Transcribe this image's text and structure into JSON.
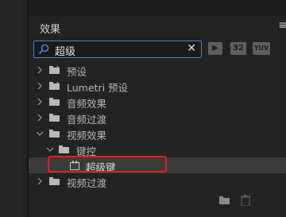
{
  "panel": {
    "title": "效果",
    "menu_icon": "≡"
  },
  "search": {
    "value": "超级",
    "clear_label": "✕"
  },
  "filters": [
    {
      "label": "▶"
    },
    {
      "label": "32"
    },
    {
      "label": "YUV"
    }
  ],
  "tree": [
    {
      "label": "预设",
      "expanded": false,
      "level": 0,
      "kind": "preset-folder"
    },
    {
      "label": "Lumetri 预设",
      "expanded": false,
      "level": 0,
      "kind": "preset-folder"
    },
    {
      "label": "音频效果",
      "expanded": false,
      "level": 0,
      "kind": "folder"
    },
    {
      "label": "音频过渡",
      "expanded": false,
      "level": 0,
      "kind": "folder"
    },
    {
      "label": "视频效果",
      "expanded": true,
      "level": 0,
      "kind": "folder"
    },
    {
      "label": "键控",
      "expanded": true,
      "level": 1,
      "kind": "folder"
    },
    {
      "label": "超级键",
      "level": 2,
      "kind": "effect",
      "selected": true
    },
    {
      "label": "视频过渡",
      "expanded": false,
      "level": 0,
      "kind": "folder"
    }
  ],
  "colors": {
    "accent": "#3f82d6",
    "highlight": "#e0201c",
    "background": "#232323"
  }
}
